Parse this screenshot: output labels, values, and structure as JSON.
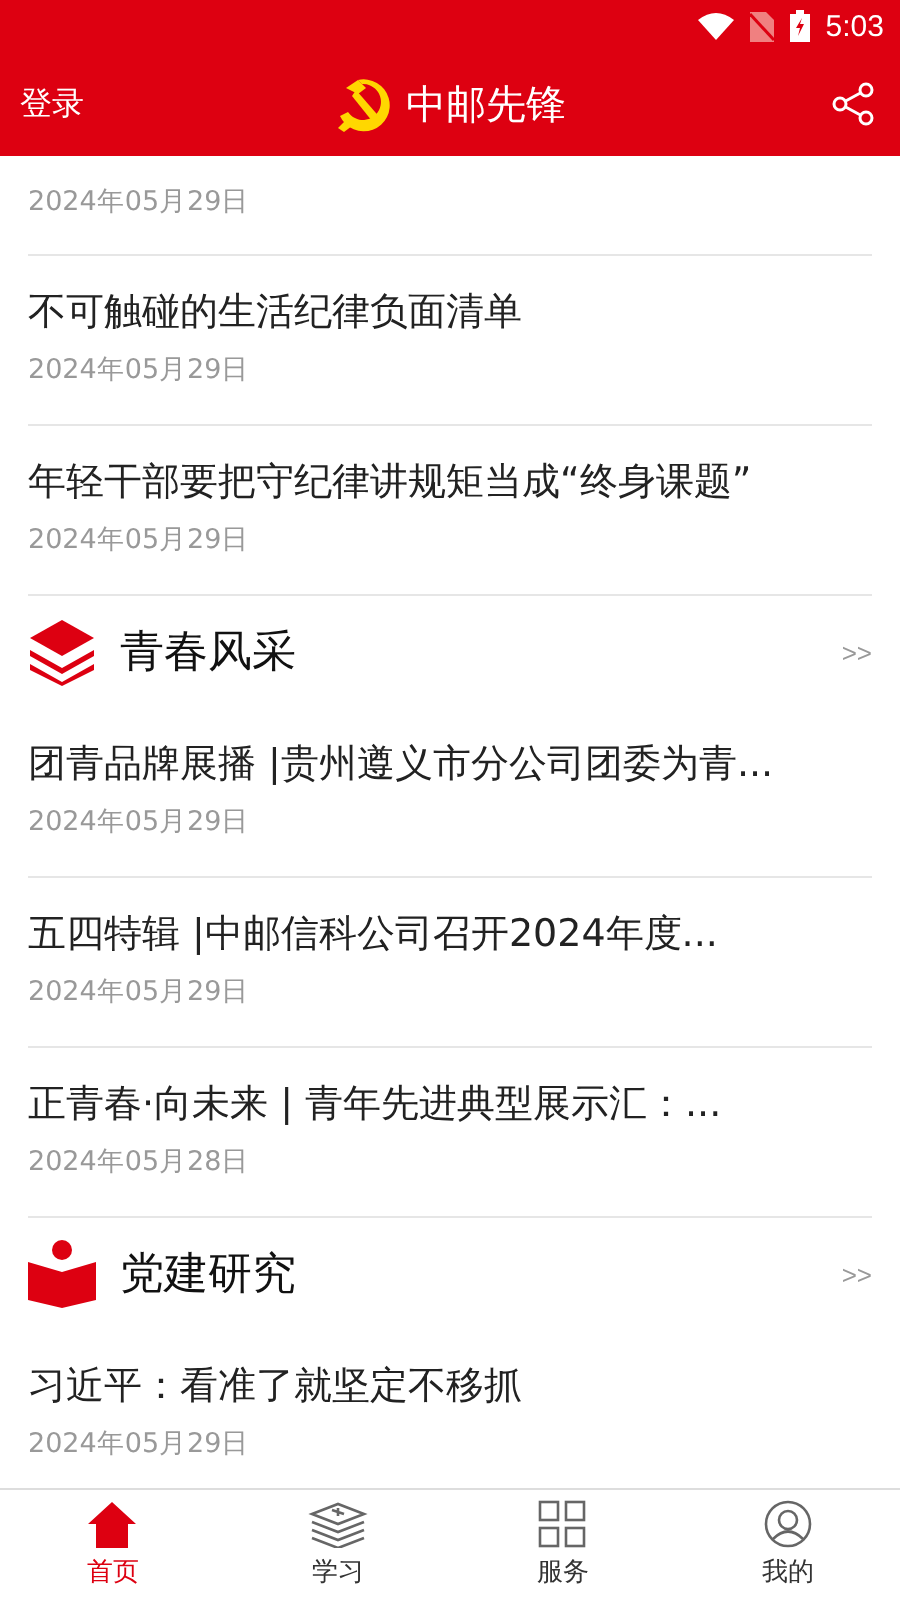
{
  "status_bar": {
    "time": "5:03"
  },
  "header": {
    "login": "登录",
    "title": "中邮先锋"
  },
  "sections": [
    {
      "items": [
        {
          "date": "2024年05月29日"
        },
        {
          "title": "不可触碰的生活纪律负面清单",
          "date": "2024年05月29日"
        },
        {
          "title": "年轻干部要把守纪律讲规矩当成“终身课题”",
          "date": "2024年05月29日"
        }
      ]
    },
    {
      "title": "青春风采",
      "kind": "layers",
      "more": ">>",
      "items": [
        {
          "title": "团青品牌展播 |贵州遵义市分公司团委为青...",
          "date": "2024年05月29日"
        },
        {
          "title": "五四特辑 |中邮信科公司召开2024年度...",
          "date": "2024年05月29日"
        },
        {
          "title": "正青春·向未来 | 青年先进典型展示汇：...",
          "date": "2024年05月28日"
        }
      ]
    },
    {
      "title": "党建研究",
      "kind": "reader",
      "more": ">>",
      "items": [
        {
          "title": "习近平：看准了就坚定不移抓",
          "date": "2024年05月29日"
        }
      ]
    }
  ],
  "tabs": [
    {
      "label": "首页",
      "kind": "home",
      "selected": true
    },
    {
      "label": "学习",
      "kind": "books",
      "selected": false
    },
    {
      "label": "服务",
      "kind": "grid",
      "selected": false
    },
    {
      "label": "我的",
      "kind": "person",
      "selected": false
    }
  ]
}
